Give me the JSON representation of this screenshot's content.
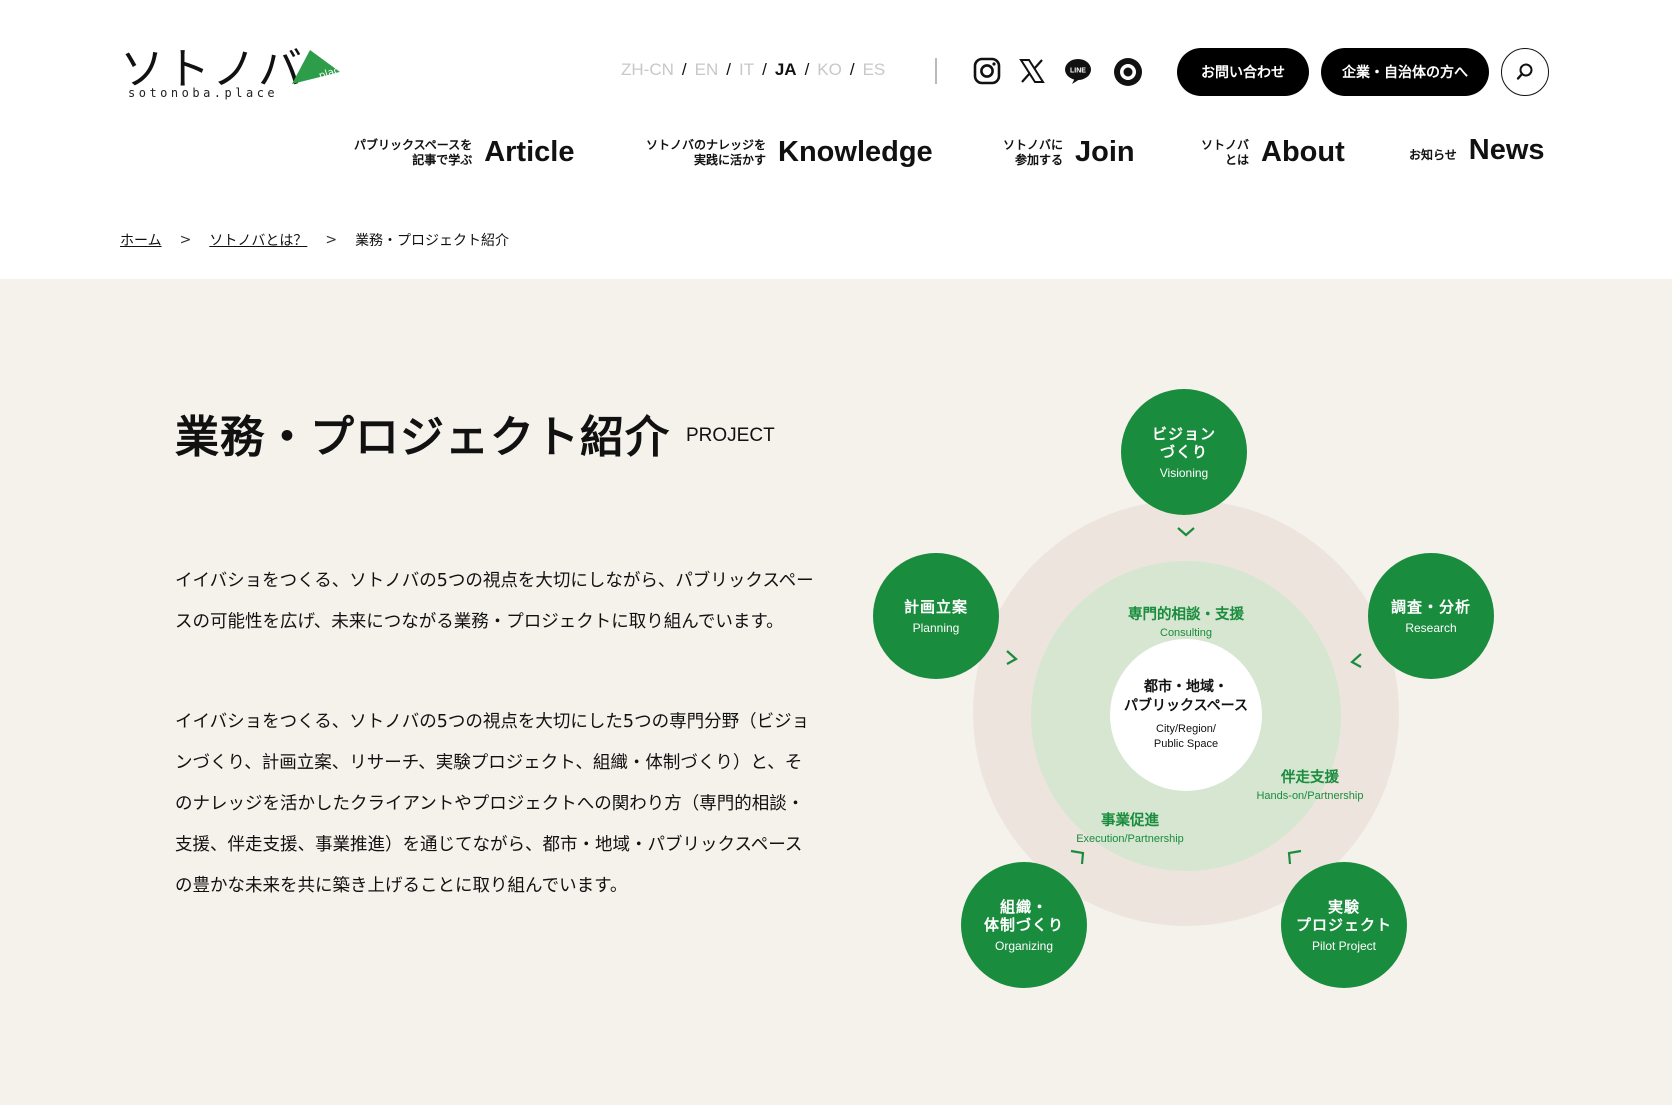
{
  "header": {
    "logo_text": "ソトノバ",
    "logo_sub": "sotonoba.place",
    "logo_badge": ".place",
    "languages": [
      {
        "code": "ZH-CN",
        "active": false
      },
      {
        "code": "EN",
        "active": false
      },
      {
        "code": "IT",
        "active": false
      },
      {
        "code": "JA",
        "active": true
      },
      {
        "code": "KO",
        "active": false
      },
      {
        "code": "ES",
        "active": false
      }
    ],
    "lang_separator": "/",
    "social": [
      "instagram-icon",
      "x-icon",
      "line-icon",
      "note-icon"
    ],
    "line_label": "LINE",
    "contact_label": "お問い合わせ",
    "corporate_label": "企業・自治体の方へ"
  },
  "nav": [
    {
      "small": "パブリックスペースを\n記事で学ぶ",
      "big": "Article"
    },
    {
      "small": "ソトノバのナレッジを\n実践に活かす",
      "big": "Knowledge"
    },
    {
      "small": "ソトノバに\n参加する",
      "big": "Join"
    },
    {
      "small": "ソトノバ\nとは",
      "big": "About"
    },
    {
      "small": "お知らせ",
      "big": "News"
    }
  ],
  "breadcrumb": {
    "items": [
      "ホーム",
      "ソトノバとは？"
    ],
    "separator": ">",
    "current": "業務・プロジェクト紹介"
  },
  "main": {
    "title": "業務・プロジェクト紹介",
    "title_en": "PROJECT",
    "paragraph1": "イイバショをつくる、ソトノバの5つの視点を大切にしながら、パブリックスペースの可能性を広げ、未来につながる業務・プロジェクトに取り組んでいます。",
    "paragraph2": "イイバショをつくる、ソトノバの5つの視点を大切にした5つの専門分野（ビジョンづくり、計画立案、リサーチ、実験プロジェクト、組織・体制づくり）と、そのナレッジを活かしたクライアントやプロジェクトへの関わり方（専門的相談・支援、伴走支援、事業推進）を通じてながら、都市・地域・パブリックスペースの豊かな未来を共に築き上げることに取り組んでいます。"
  },
  "diagram": {
    "center": {
      "ja": "都市・地域・\nパブリックスペース",
      "en": "City/Region/\nPublic Space"
    },
    "nodes": [
      {
        "ja": "ビジョン\nづくり",
        "en": "Visioning"
      },
      {
        "ja": "調査・分析",
        "en": "Research"
      },
      {
        "ja": "実験\nプロジェクト",
        "en": "Pilot Project"
      },
      {
        "ja": "組織・\n体制づくり",
        "en": "Organizing"
      },
      {
        "ja": "計画立案",
        "en": "Planning"
      }
    ],
    "modes": [
      {
        "ja": "専門的相談・支援",
        "en": "Consulting"
      },
      {
        "ja": "伴走支援",
        "en": "Hands-on/Partnership"
      },
      {
        "ja": "事業促進",
        "en": "Execution/Partnership"
      }
    ],
    "colors": {
      "green": "#1a8c3e",
      "outer_ring": "#ede5dd",
      "inner_ring": "#d6e6d1"
    }
  }
}
